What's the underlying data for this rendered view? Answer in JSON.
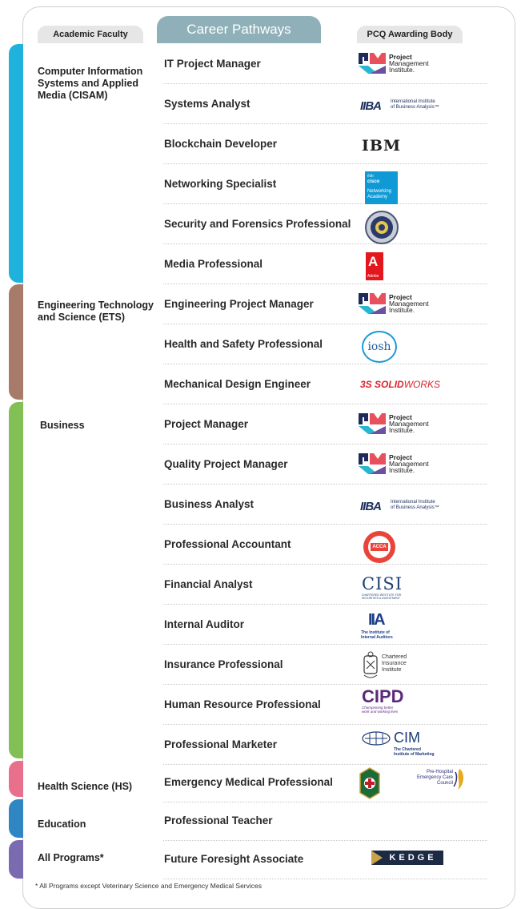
{
  "headers": {
    "faculty": "Academic Faculty",
    "pathways": "Career Pathways",
    "body": "PCQ Awarding Body"
  },
  "colors": {
    "cisam": "#1fb2dd",
    "ets": "#a87a6a",
    "business": "#82bf55",
    "hs": "#e8708d",
    "education": "#2f86c3",
    "all": "#7a6bb0"
  },
  "faculties": {
    "cisam": "Computer Information Systems and Applied Media (CISAM)",
    "ets": "Engineering Technology and Science (ETS)",
    "business": "Business",
    "hs": "Health Science (HS)",
    "education": "Education",
    "all": "All Programs*"
  },
  "rows": [
    {
      "name": "IT Project Manager",
      "logo": "pmi-logo"
    },
    {
      "name": "Systems Analyst",
      "logo": "iiba-logo"
    },
    {
      "name": "Blockchain Developer",
      "logo": "ibm-logo"
    },
    {
      "name": "Networking Specialist",
      "logo": "cisco-logo"
    },
    {
      "name": "Security and Forensics Professional",
      "logo": "seal-logo"
    },
    {
      "name": "Media Professional",
      "logo": "adobe-logo"
    },
    {
      "name": "Engineering Project Manager",
      "logo": "pmi-logo"
    },
    {
      "name": "Health and Safety Professional",
      "logo": "iosh-logo"
    },
    {
      "name": "Mechanical Design Engineer",
      "logo": "solidworks-logo"
    },
    {
      "name": "Project Manager",
      "logo": "pmi-logo"
    },
    {
      "name": "Quality Project Manager",
      "logo": "pmi-logo"
    },
    {
      "name": "Business Analyst",
      "logo": "iiba-logo"
    },
    {
      "name": "Professional Accountant",
      "logo": "acca-logo"
    },
    {
      "name": "Financial Analyst",
      "logo": "cisi-logo"
    },
    {
      "name": "Internal Auditor",
      "logo": "iia-logo"
    },
    {
      "name": "Insurance Professional",
      "logo": "cii-logo"
    },
    {
      "name": "Human Resource Professional",
      "logo": "cipd-logo"
    },
    {
      "name": "Professional Marketer",
      "logo": "cim-logo"
    },
    {
      "name": "Emergency Medical Professional",
      "logo": "phecc-logo"
    },
    {
      "name": "Professional Teacher",
      "logo": ""
    },
    {
      "name": "Future Foresight Associate",
      "logo": "kedge-logo"
    }
  ],
  "logo_text": {
    "pmi_1": "Project",
    "pmi_2": "Management",
    "pmi_3": "Institute.",
    "iiba_mark": "IIBA",
    "iiba_1": "International Institute",
    "iiba_2": "of Business Analysis™",
    "ibm": "IBM",
    "cisco_1": "cisco",
    "cisco_2": "Networking",
    "cisco_3": "Academy",
    "adobe": "Adobe",
    "iosh": "iosh",
    "solidworks_ds": "3S",
    "solidworks_1": "SOLID",
    "solidworks_2": "WORKS",
    "acca_ring": "ACCREDITED PROGRAMME",
    "acca": "ACCA",
    "cisi": "CISI",
    "cisi_sub": "CHARTERED INSTITUTE FOR SECURITIES & INVESTMENT",
    "iia_mark": "IIA",
    "iia_1": "The Institute of",
    "iia_2": "Internal Auditors",
    "cii_1": "Chartered",
    "cii_2": "Insurance",
    "cii_3": "Institute",
    "cipd": "CIPD",
    "cipd_1": "Championing better",
    "cipd_2": "work and working lives",
    "cim": "CIM",
    "cim_1": "The Chartered",
    "cim_2": "Institute of Marketing",
    "phecc_1": "Pre-Hospital",
    "phecc_2": "Emergency Care",
    "phecc_3": "Council",
    "kedge": "KEDGE"
  },
  "footnote": "* All Programs except Veterinary Science and Emergency Medical Services"
}
